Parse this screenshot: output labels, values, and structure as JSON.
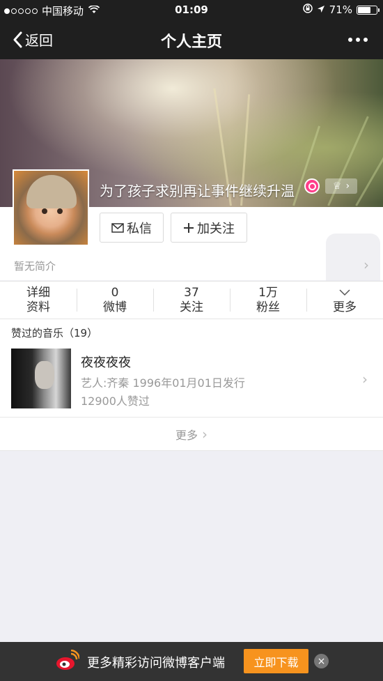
{
  "status_bar": {
    "carrier": "中国移动",
    "time": "01:09",
    "battery": "71%",
    "battery_level": 0.71
  },
  "nav": {
    "back_label": "返回",
    "title": "个人主页"
  },
  "profile": {
    "name": "为了孩子求别再让事件继续升温",
    "bio": "暂无简介"
  },
  "actions": {
    "message_label": "私信",
    "follow_label": "加关注"
  },
  "stats": [
    {
      "value": "详细",
      "label": "资料"
    },
    {
      "value": "0",
      "label": "微博"
    },
    {
      "value": "37",
      "label": "关注"
    },
    {
      "value": "1万",
      "label": "粉丝"
    },
    {
      "value": "",
      "label": "更多"
    }
  ],
  "liked_music": {
    "header": "赞过的音乐（19）",
    "items": [
      {
        "title": "夜夜夜夜",
        "artist_line": "艺人:齐秦 1996年01月01日发行",
        "likes": "12900人赞过"
      }
    ],
    "more_label": "更多"
  },
  "bottom_banner": {
    "text": "更多精彩访问微博客户端",
    "download_label": "立即下载",
    "close_glyph": "×"
  },
  "colors": {
    "accent_orange": "#f7931e",
    "nav_bg": "#1f1f1f",
    "vip_pink": "#ff3d8a"
  }
}
